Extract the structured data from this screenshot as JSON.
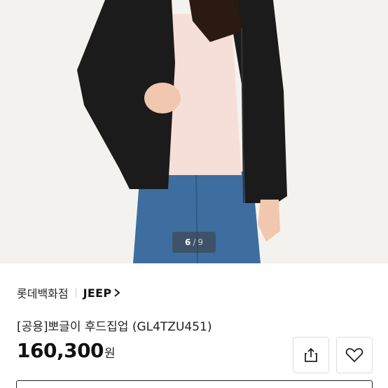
{
  "gallery": {
    "current": "6",
    "separator": "/",
    "total": "9"
  },
  "product": {
    "store": "롯데백화점",
    "brand": "JEEP",
    "title": "[공용]뽀글이 후드집업 (GL4TZU451)",
    "price": "160,300",
    "currency": "원"
  },
  "icons": {
    "share": "share-icon",
    "wishlist": "heart-icon",
    "brand_link": "chevron-right-icon"
  },
  "colors": {
    "photo_bg": "#f4f2ee",
    "jacket": "#1a1a1a",
    "jeans": "#3e6ea0"
  }
}
